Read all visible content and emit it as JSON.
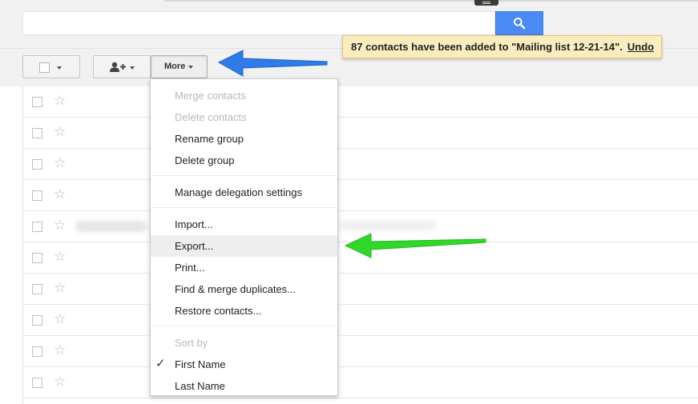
{
  "search": {
    "value": "",
    "button_icon": "search-icon"
  },
  "notification": {
    "message": "87 contacts have been added to \"Mailing list 12-21-14\".",
    "undo_label": "Undo"
  },
  "toolbar": {
    "select_icon": "checkbox-icon",
    "add_icon": "add-contact-icon",
    "more_label": "More"
  },
  "menu": {
    "items": [
      {
        "label": "Merge contacts",
        "enabled": false
      },
      {
        "label": "Delete contacts",
        "enabled": false
      },
      {
        "label": "Rename group",
        "enabled": true
      },
      {
        "label": "Delete group",
        "enabled": true
      },
      {
        "label": "Manage delegation settings",
        "enabled": true
      },
      {
        "label": "Import...",
        "enabled": true
      },
      {
        "label": "Export...",
        "enabled": true,
        "highlighted": true
      },
      {
        "label": "Print...",
        "enabled": true
      },
      {
        "label": "Find & merge duplicates...",
        "enabled": true
      },
      {
        "label": "Restore contacts...",
        "enabled": true
      }
    ],
    "sort_header": "Sort by",
    "sort_options": [
      {
        "label": "First Name",
        "checked": true
      },
      {
        "label": "Last Name",
        "checked": false
      }
    ]
  },
  "contact_rows": 10,
  "colors": {
    "search_button": "#4a8af4",
    "notification_bg": "#f9edbe",
    "blue_arrow": "#2f7bea",
    "green_arrow": "#2fd82a"
  }
}
